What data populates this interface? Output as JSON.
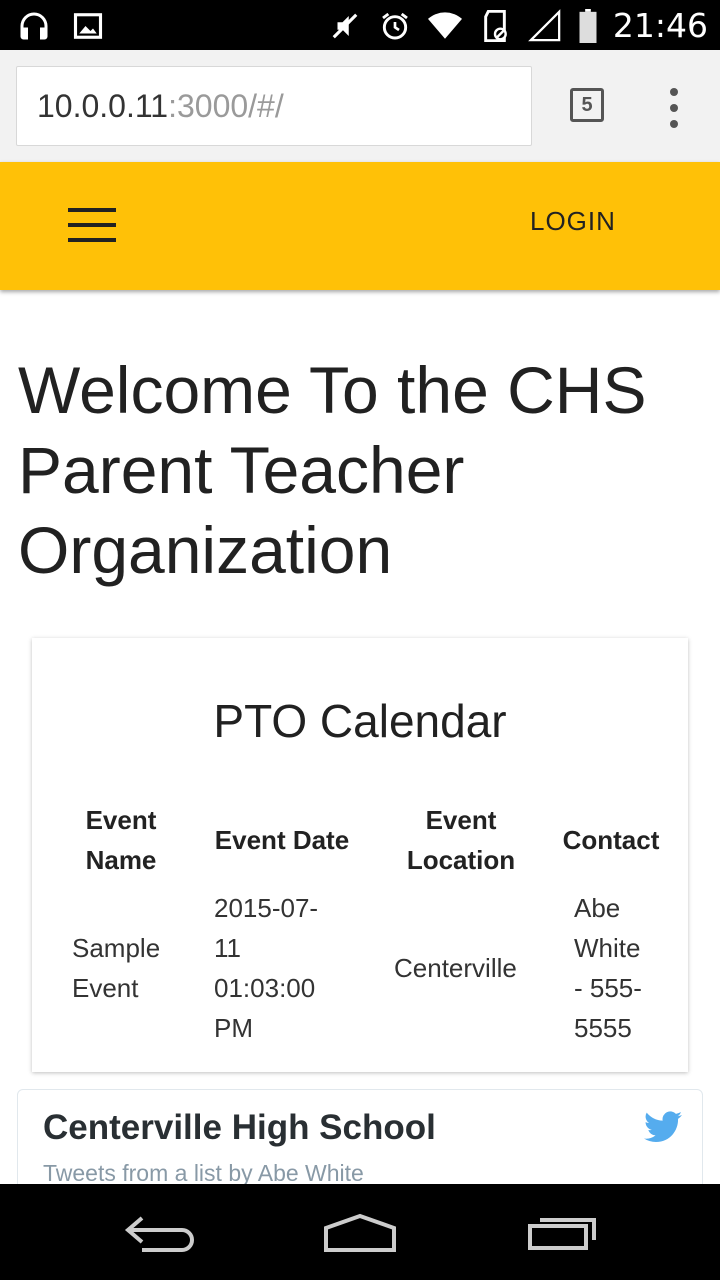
{
  "status_bar": {
    "time": "21:46",
    "left_icons": [
      "headphones-icon",
      "image-icon"
    ],
    "right_icons": [
      "mute-icon",
      "alarm-icon",
      "wifi-icon",
      "sd-card-icon",
      "signal-icon",
      "battery-icon"
    ]
  },
  "browser": {
    "url_host": "10.0.0.11",
    "url_rest": ":3000/#/",
    "tab_count": "5"
  },
  "app_bar": {
    "login_label": "LOGIN"
  },
  "page": {
    "title": "Welcome To the CHS Parent Teacher Organization"
  },
  "calendar": {
    "title": "PTO Calendar",
    "columns": [
      "Event Name",
      "Event Date",
      "Event Location",
      "Contact"
    ],
    "rows": [
      [
        "Sample Event",
        "2015-07-11 01:03:00 PM",
        "Centerville",
        "Abe White - 555-5555"
      ]
    ]
  },
  "twitter": {
    "title": "Centerville High School",
    "subtitle": "Tweets from a list by Abe White",
    "accent": "#55acee"
  },
  "nav_bar": [
    "back-icon",
    "home-icon",
    "recent-apps-icon"
  ],
  "colors": {
    "app_bar": "#ffc107",
    "status_bar": "#000000"
  }
}
